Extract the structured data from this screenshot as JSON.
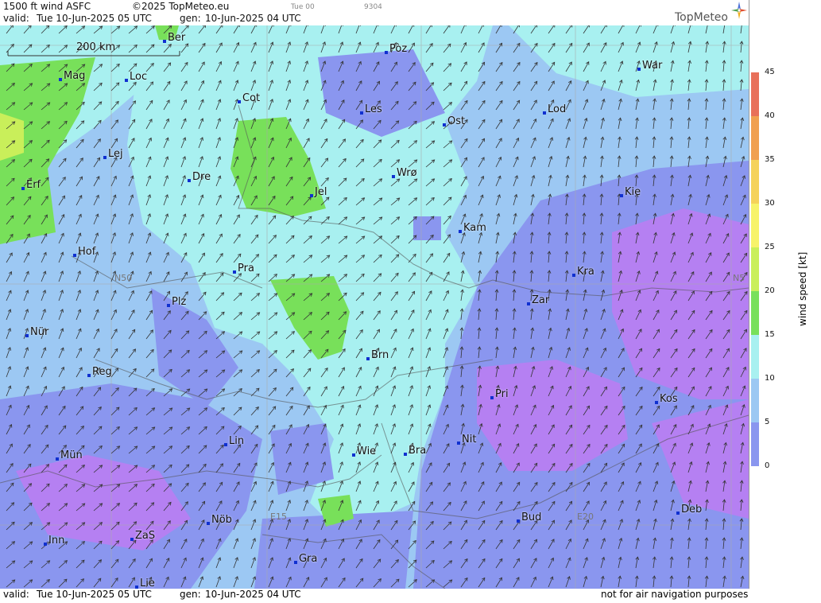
{
  "header": {
    "product": "1500 ft wind ASFC",
    "copyright": "©2025 TopMeteo.eu",
    "small_time": "Tue 00",
    "small_code": "9304",
    "valid_label": "valid:",
    "valid_value": "Tue  10-Jun-2025  05 UTC",
    "gen_label": "gen:",
    "gen_value": "10-Jun-2025 04 UTC",
    "brand": "TopMeteo"
  },
  "scale_bar": "200 km",
  "grid_labels": {
    "lat": "N50",
    "lat_right": "N5",
    "lon1": "E15",
    "lon2": "E20"
  },
  "cities": [
    "Ber",
    "Pòz",
    "War",
    "Mag",
    "Loc",
    "Cot",
    "Les",
    "Ost",
    "Lod",
    "Lej",
    "Dre",
    "Wrø",
    "Jel",
    "Kie",
    "Erf",
    "Kam",
    "Hof",
    "Pra",
    "Kra",
    "Zar",
    "Plz",
    "Nür",
    "Brn",
    "Reg",
    "Pri",
    "Kos",
    "Lin",
    "Nit",
    "Mün",
    "Wie",
    "Bra",
    "Deb",
    "Nöb",
    "Bud",
    "E20",
    "Inn",
    "ZaS",
    "Gra",
    "Lie"
  ],
  "legend": {
    "title": "wind speed [kt]",
    "ticks": [
      "45",
      "40",
      "35",
      "30",
      "25",
      "20",
      "15",
      "10",
      "5",
      "0"
    ],
    "colors": [
      "#e8705a",
      "#f0a050",
      "#f5d25a",
      "#f7f36a",
      "#c9ef5a",
      "#78e05a",
      "#a8f0f0",
      "#9cc8f3",
      "#8a96ef",
      "#b580f2"
    ]
  },
  "footer": {
    "valid_label": "valid:",
    "valid_value": "Tue   10-Jun-2025   05 UTC",
    "gen_label": "gen:",
    "gen_value": "10-Jun-2025 04 UTC",
    "disclaimer": "not for air navigation purposes"
  }
}
